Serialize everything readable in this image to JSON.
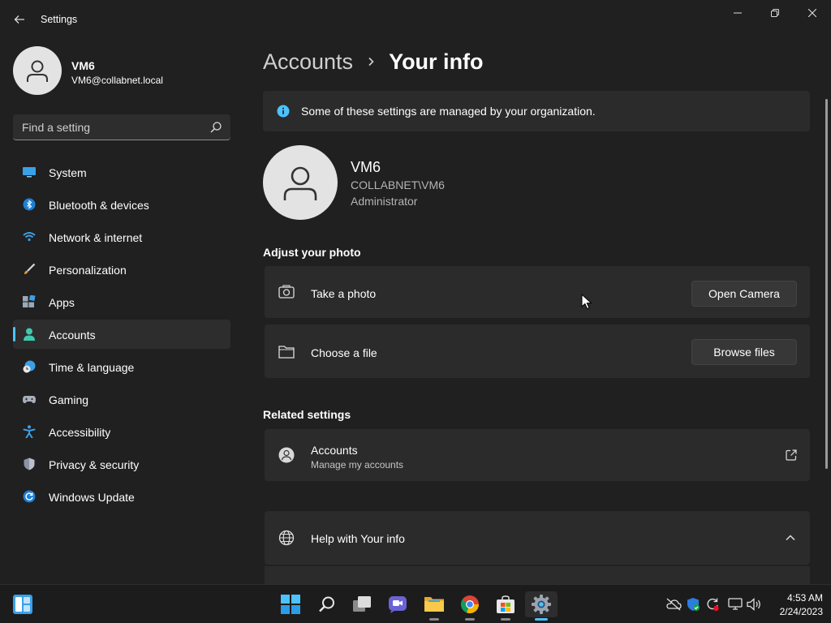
{
  "window": {
    "title": "Settings"
  },
  "profile": {
    "name": "VM6",
    "email": "VM6@collabnet.local"
  },
  "search": {
    "placeholder": "Find a setting"
  },
  "sidebar": {
    "items": [
      {
        "label": "System",
        "icon": "monitor-icon"
      },
      {
        "label": "Bluetooth & devices",
        "icon": "bluetooth-icon"
      },
      {
        "label": "Network & internet",
        "icon": "wifi-icon"
      },
      {
        "label": "Personalization",
        "icon": "brush-icon"
      },
      {
        "label": "Apps",
        "icon": "apps-icon"
      },
      {
        "label": "Accounts",
        "icon": "person-icon",
        "active": true
      },
      {
        "label": "Time & language",
        "icon": "clock-globe-icon"
      },
      {
        "label": "Gaming",
        "icon": "gamepad-icon"
      },
      {
        "label": "Accessibility",
        "icon": "accessibility-icon"
      },
      {
        "label": "Privacy & security",
        "icon": "shield-icon"
      },
      {
        "label": "Windows Update",
        "icon": "update-icon"
      }
    ]
  },
  "breadcrumb": {
    "parent": "Accounts",
    "current": "Your info"
  },
  "info_bar": {
    "text": "Some of these settings are managed by your organization."
  },
  "user": {
    "name": "VM6",
    "domain": "COLLABNET\\VM6",
    "role": "Administrator"
  },
  "adjust_photo": {
    "heading": "Adjust your photo",
    "take_photo": {
      "label": "Take a photo",
      "button": "Open Camera"
    },
    "choose_file": {
      "label": "Choose a file",
      "button": "Browse files"
    }
  },
  "related": {
    "heading": "Related settings",
    "accounts": {
      "label": "Accounts",
      "sub": "Manage my accounts"
    }
  },
  "help": {
    "label": "Help with Your info"
  },
  "taskbar": {
    "time": "4:53 AM",
    "date": "2/24/2023"
  },
  "colors": {
    "accent": "#4cc2ff",
    "background": "#202020",
    "card": "#2b2b2b"
  }
}
